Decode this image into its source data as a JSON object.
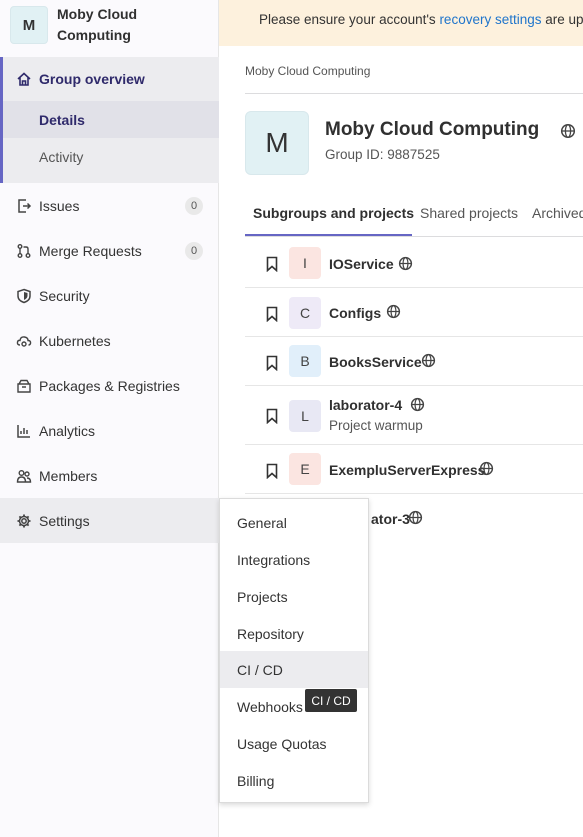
{
  "sidebar": {
    "group_initial": "M",
    "group_name": "Moby Cloud Computing",
    "group_overview": "Group overview",
    "details": "Details",
    "activity": "Activity",
    "items": [
      {
        "label": "Issues",
        "count": "0",
        "icon": "issues-icon"
      },
      {
        "label": "Merge Requests",
        "count": "0",
        "icon": "merge-request-icon"
      },
      {
        "label": "Security",
        "icon": "shield-icon"
      },
      {
        "label": "Kubernetes",
        "icon": "cloud-gear-icon"
      },
      {
        "label": "Packages & Registries",
        "icon": "package-icon"
      },
      {
        "label": "Analytics",
        "icon": "chart-icon"
      },
      {
        "label": "Members",
        "icon": "users-icon"
      },
      {
        "label": "Settings",
        "icon": "gear-icon"
      }
    ]
  },
  "alert": {
    "prefix": "Please ensure your account's ",
    "link": "recovery settings",
    "suffix": " are up"
  },
  "breadcrumb": "Moby Cloud Computing",
  "group": {
    "initial": "M",
    "title": "Moby Cloud Computing",
    "id_text": "Group ID: 9887525"
  },
  "tabs": [
    "Subgroups and projects",
    "Shared projects",
    "Archived"
  ],
  "projects": [
    {
      "initial": "I",
      "name": "IOService",
      "color": "#fbe5e1"
    },
    {
      "initial": "C",
      "name": "Configs",
      "color": "#eeeaf7"
    },
    {
      "initial": "B",
      "name": "BooksService",
      "color": "#e1effa"
    },
    {
      "initial": "L",
      "name": "laborator-4",
      "description": "Project warmup",
      "color": "#e8e8f4"
    },
    {
      "initial": "E",
      "name": "ExempluServerExpress",
      "color": "#fbe5e1"
    },
    {
      "name": "ator-3"
    }
  ],
  "settings_menu": [
    "General",
    "Integrations",
    "Projects",
    "Repository",
    "CI / CD",
    "Webhooks",
    "Usage Quotas",
    "Billing"
  ],
  "tooltip": "CI / CD",
  "colors": {
    "accent": "#6666c4",
    "alert_bg": "#fdf1dd",
    "link": "#1f75cb"
  }
}
